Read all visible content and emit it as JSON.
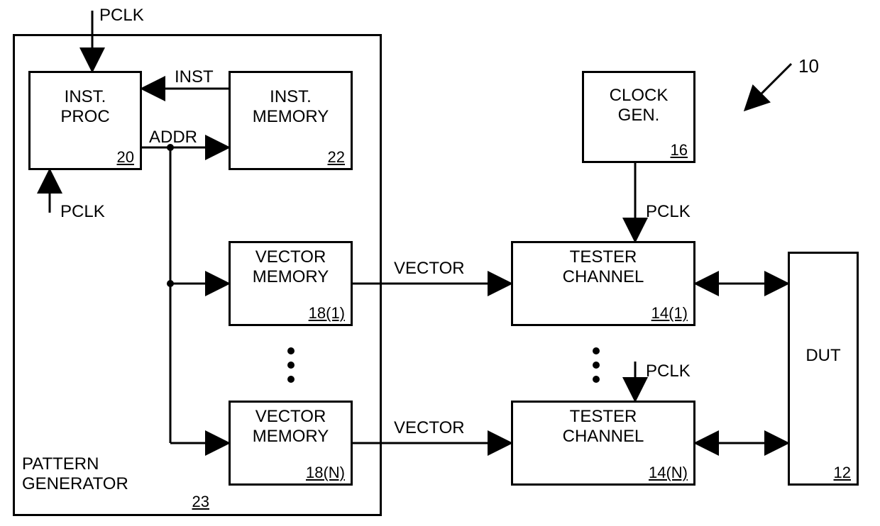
{
  "diagram": {
    "ref_number": "10",
    "outer": {
      "title_l1": "PATTERN",
      "title_l2": "GENERATOR",
      "ref": "23"
    },
    "inst_proc": {
      "l1": "INST.",
      "l2": "PROC",
      "ref": "20"
    },
    "inst_mem": {
      "l1": "INST.",
      "l2": "MEMORY",
      "ref": "22"
    },
    "vec_mem1": {
      "l1": "VECTOR",
      "l2": "MEMORY",
      "ref": "18(1)"
    },
    "vec_memN": {
      "l1": "VECTOR",
      "l2": "MEMORY",
      "ref": "18(N)"
    },
    "clock_gen": {
      "l1": "CLOCK",
      "l2": "GEN.",
      "ref": "16"
    },
    "tester1": {
      "l1": "TESTER",
      "l2": "CHANNEL",
      "ref": "14(1)"
    },
    "testerN": {
      "l1": "TESTER",
      "l2": "CHANNEL",
      "ref": "14(N)"
    },
    "dut": {
      "l1": "DUT",
      "ref": "12"
    },
    "signals": {
      "pclk": "PCLK",
      "inst": "INST",
      "addr": "ADDR",
      "vector": "VECTOR"
    }
  }
}
